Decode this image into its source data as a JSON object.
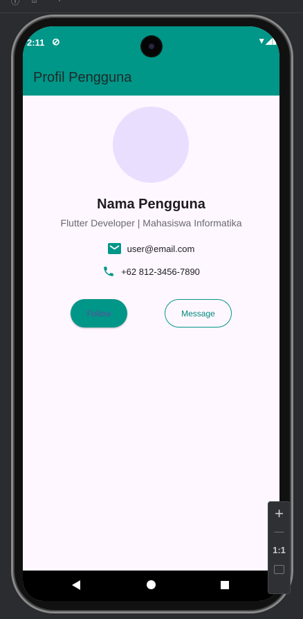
{
  "status_bar": {
    "time": "2:11"
  },
  "app_bar": {
    "title": "Profil Pengguna"
  },
  "profile": {
    "name": "Nama Pengguna",
    "subtitle": "Flutter Developer | Mahasiswa Informatika",
    "email": "user@email.com",
    "phone": "+62 812-3456-7890"
  },
  "buttons": {
    "follow": "Follow",
    "message": "Message"
  },
  "zoom_controls": {
    "plus": "+",
    "minus": "—",
    "reset": "1:1"
  },
  "colors": {
    "primary": "#009688",
    "background": "#fef7ff",
    "avatar": "#eadeff"
  }
}
